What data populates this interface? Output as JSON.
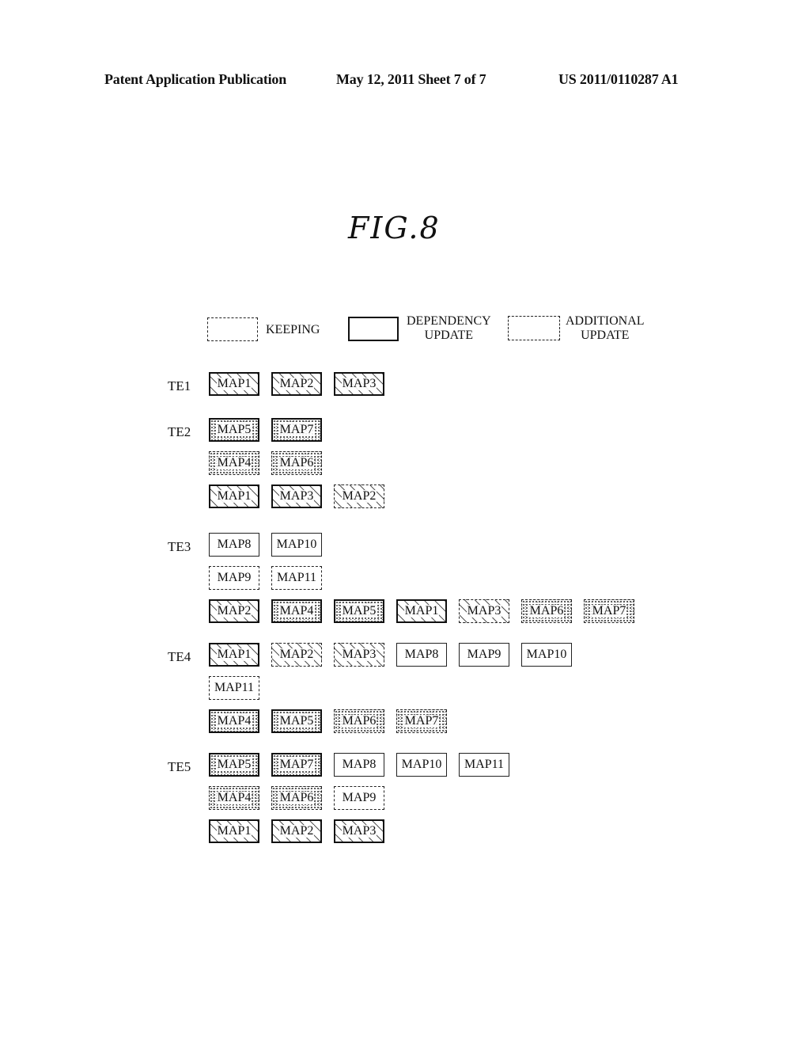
{
  "header": {
    "left": "Patent Application Publication",
    "middle": "May 12, 2011   Sheet 7 of 7",
    "right": "US 2011/0110287 A1"
  },
  "figure": {
    "title": "FIG.8"
  },
  "legend": [
    {
      "style": "keeping",
      "label": "KEEPING"
    },
    {
      "style": "dependency",
      "label": "DEPENDENCY\nUPDATE",
      "line1": "DEPENDENCY",
      "line2": "UPDATE"
    },
    {
      "style": "additional",
      "label": "ADDITIONAL\nUPDATE",
      "line1": "ADDITIONAL",
      "line2": "UPDATE"
    }
  ],
  "groups": [
    {
      "label": "TE1",
      "rows": [
        [
          {
            "name": "MAP1",
            "border": "medium",
            "fill": "hatch"
          },
          {
            "name": "MAP2",
            "border": "medium",
            "fill": "hatch"
          },
          {
            "name": "MAP3",
            "border": "medium",
            "fill": "hatch"
          }
        ]
      ]
    },
    {
      "label": "TE2",
      "rows": [
        [
          {
            "name": "MAP5",
            "border": "medium",
            "fill": "stipple"
          },
          {
            "name": "MAP7",
            "border": "medium",
            "fill": "stipple"
          }
        ],
        [
          {
            "name": "MAP4",
            "border": "additional",
            "fill": "stipple"
          },
          {
            "name": "MAP6",
            "border": "additional",
            "fill": "stipple"
          }
        ],
        [
          {
            "name": "MAP1",
            "border": "dependency",
            "fill": "hatch"
          },
          {
            "name": "MAP3",
            "border": "dependency",
            "fill": "hatch"
          },
          {
            "name": "MAP2",
            "border": "additional",
            "fill": "hatch"
          }
        ]
      ]
    },
    {
      "label": "TE3",
      "rows": [
        [
          {
            "name": "MAP8",
            "border": "solid",
            "fill": "none"
          },
          {
            "name": "MAP10",
            "border": "solid",
            "fill": "none"
          }
        ],
        [
          {
            "name": "MAP9",
            "border": "keeping",
            "fill": "none"
          },
          {
            "name": "MAP11",
            "border": "keeping",
            "fill": "none"
          }
        ],
        [
          {
            "name": "MAP2",
            "border": "dependency",
            "fill": "hatch"
          },
          {
            "name": "MAP4",
            "border": "dependency",
            "fill": "stipple"
          },
          {
            "name": "MAP5",
            "border": "dependency",
            "fill": "stipple"
          },
          {
            "name": "MAP1",
            "border": "dependency",
            "fill": "hatch"
          },
          {
            "name": "MAP3",
            "border": "additional",
            "fill": "hatch"
          },
          {
            "name": "MAP6",
            "border": "additional",
            "fill": "stipple"
          },
          {
            "name": "MAP7",
            "border": "additional",
            "fill": "stipple"
          }
        ]
      ]
    },
    {
      "label": "TE4",
      "rows": [
        [
          {
            "name": "MAP1",
            "border": "medium",
            "fill": "hatch"
          },
          {
            "name": "MAP2",
            "border": "additional",
            "fill": "hatch"
          },
          {
            "name": "MAP3",
            "border": "additional",
            "fill": "hatch"
          },
          {
            "name": "MAP8",
            "border": "solid",
            "fill": "none"
          },
          {
            "name": "MAP9",
            "border": "solid",
            "fill": "none"
          },
          {
            "name": "MAP10",
            "border": "solid",
            "fill": "none"
          }
        ],
        [
          {
            "name": "MAP11",
            "border": "keeping",
            "fill": "none"
          }
        ],
        [
          {
            "name": "MAP4",
            "border": "dependency",
            "fill": "stipple"
          },
          {
            "name": "MAP5",
            "border": "dependency",
            "fill": "stipple"
          },
          {
            "name": "MAP6",
            "border": "additional",
            "fill": "stipple"
          },
          {
            "name": "MAP7",
            "border": "additional",
            "fill": "stipple"
          }
        ]
      ]
    },
    {
      "label": "TE5",
      "rows": [
        [
          {
            "name": "MAP5",
            "border": "dependency",
            "fill": "stipple"
          },
          {
            "name": "MAP7",
            "border": "dependency",
            "fill": "stipple"
          },
          {
            "name": "MAP8",
            "border": "solid",
            "fill": "none"
          },
          {
            "name": "MAP10",
            "border": "solid",
            "fill": "none"
          },
          {
            "name": "MAP11",
            "border": "solid",
            "fill": "none"
          }
        ],
        [
          {
            "name": "MAP4",
            "border": "additional",
            "fill": "stipple"
          },
          {
            "name": "MAP6",
            "border": "additional",
            "fill": "stipple"
          },
          {
            "name": "MAP9",
            "border": "keeping",
            "fill": "none"
          }
        ],
        [
          {
            "name": "MAP1",
            "border": "dependency",
            "fill": "hatch"
          },
          {
            "name": "MAP2",
            "border": "dependency",
            "fill": "hatch"
          },
          {
            "name": "MAP3",
            "border": "dependency",
            "fill": "hatch"
          }
        ]
      ]
    }
  ]
}
